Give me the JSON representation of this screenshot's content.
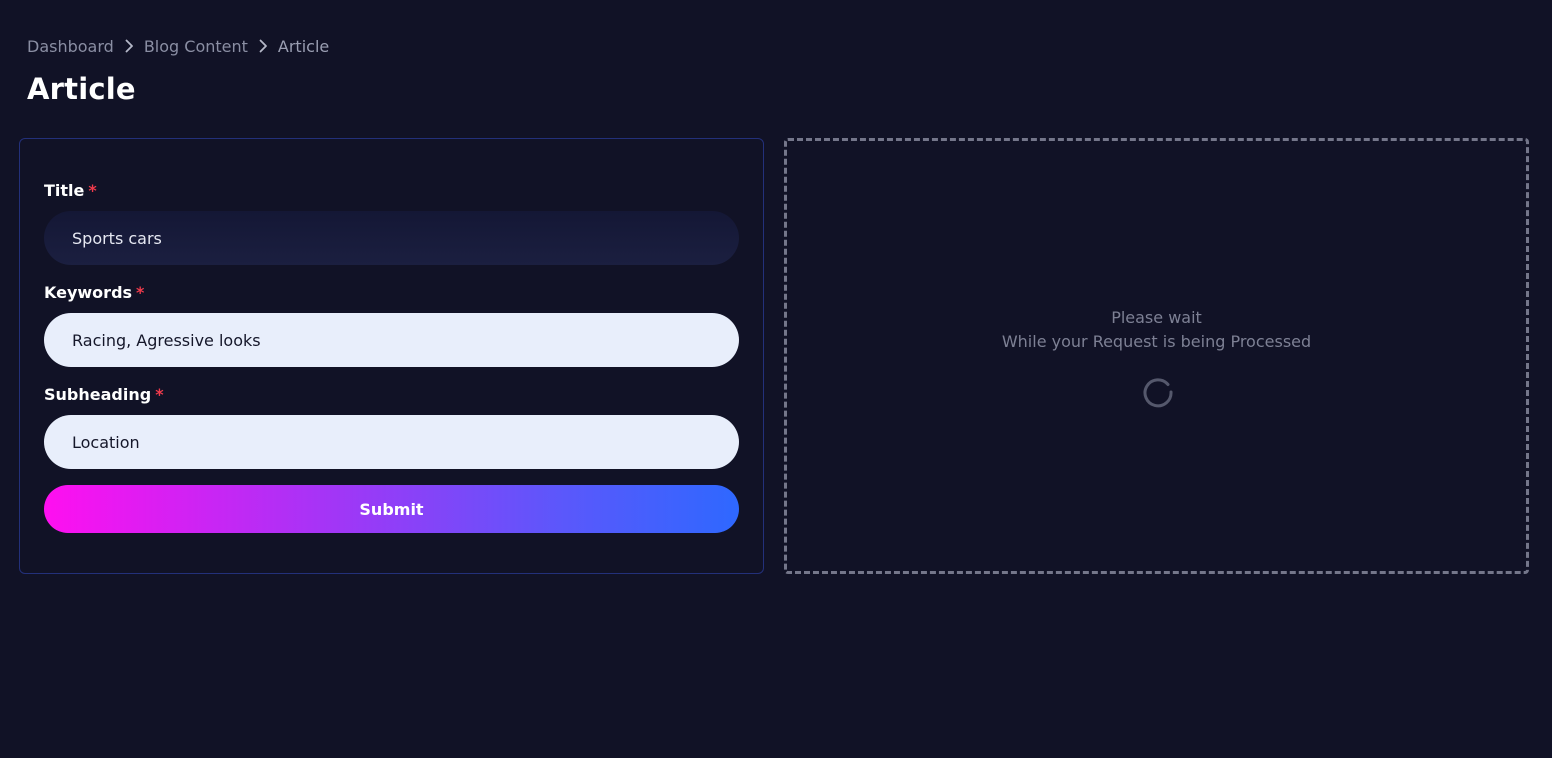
{
  "breadcrumb": {
    "items": [
      {
        "label": "Dashboard"
      },
      {
        "label": "Blog Content"
      },
      {
        "label": "Article"
      }
    ]
  },
  "page": {
    "title": "Article"
  },
  "form": {
    "fields": {
      "title": {
        "label": "Title",
        "required_mark": "*",
        "value": "Sports cars"
      },
      "keywords": {
        "label": "Keywords",
        "required_mark": "*",
        "value": "Racing, Agressive looks"
      },
      "subheading": {
        "label": "Subheading",
        "required_mark": "*",
        "value": "Location"
      }
    },
    "submit_label": "Submit"
  },
  "processing": {
    "line1": "Please wait",
    "line2": "While your Request is being Processed",
    "spinner_icon": "loading-spinner-icon"
  },
  "colors": {
    "background": "#111226",
    "accent_gradient_start": "#ff0ff0",
    "accent_gradient_end": "#2e68ff",
    "required_mark": "#ef3b4c"
  }
}
